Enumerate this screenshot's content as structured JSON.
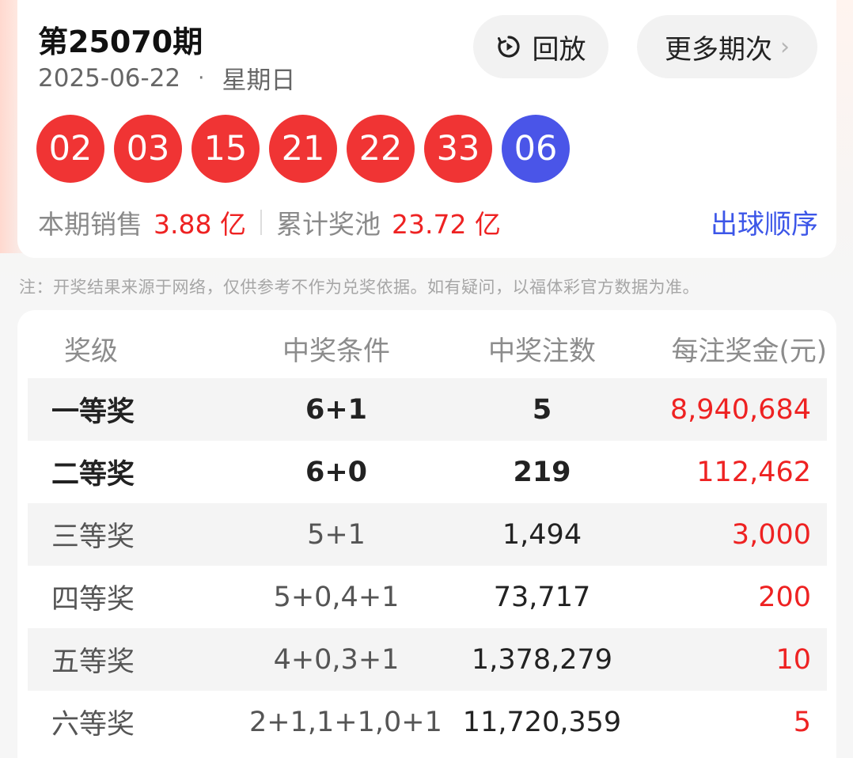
{
  "draw": {
    "issue": "第25070期",
    "date": "2025-06-22",
    "dot": "·",
    "weekday": "星期日",
    "replay_label": "回放",
    "more_label": "更多期次",
    "more_chevron": "›",
    "red_balls": [
      "02",
      "03",
      "15",
      "21",
      "22",
      "33"
    ],
    "blue_ball": "06",
    "sales_label": "本期销售",
    "sales_amount": "3.88 亿",
    "pool_label": "累计奖池",
    "pool_amount": "23.72 亿",
    "order_link": "出球顺序"
  },
  "note": "注：开奖结果来源于网络，仅供参考不作为兑奖依据。如有疑问，以福体彩官方数据为准。",
  "prize_table": {
    "headers": {
      "level": "奖级",
      "condition": "中奖条件",
      "count": "中奖注数",
      "amount": "每注奖金(元)"
    },
    "rows": [
      {
        "level": "一等奖",
        "condition": "6+1",
        "count": "5",
        "amount": "8,940,684"
      },
      {
        "level": "二等奖",
        "condition": "6+0",
        "count": "219",
        "amount": "112,462"
      },
      {
        "level": "三等奖",
        "condition": "5+1",
        "count": "1,494",
        "amount": "3,000"
      },
      {
        "level": "四等奖",
        "condition": "5+0,4+1",
        "count": "73,717",
        "amount": "200"
      },
      {
        "level": "五等奖",
        "condition": "4+0,3+1",
        "count": "1,378,279",
        "amount": "10"
      },
      {
        "level": "六等奖",
        "condition": "2+1,1+1,0+1",
        "count": "11,720,359",
        "amount": "5"
      }
    ]
  },
  "colors": {
    "red_ball": "#f03434",
    "blue_ball": "#4a55e8",
    "accent_red": "#ee2222",
    "link_blue": "#3c56e8"
  },
  "icons": {
    "replay": "replay-icon",
    "more": "chevron-right-icon"
  }
}
